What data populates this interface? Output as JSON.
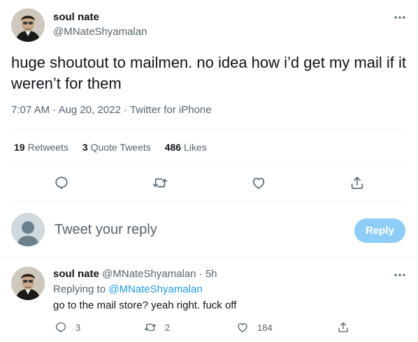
{
  "tweet": {
    "author_name": "soul nate",
    "author_handle": "@MNateShyamalan",
    "text": "huge shoutout to mailmen. no idea how i’d get my mail if it weren’t for them",
    "time": "7:07 AM",
    "date": "Aug 20, 2022",
    "source": "Twitter for iPhone",
    "separator": "·"
  },
  "stats": {
    "retweets_count": "19",
    "retweets_label": "Retweets",
    "quotes_count": "3",
    "quotes_label": "Quote Tweets",
    "likes_count": "486",
    "likes_label": "Likes"
  },
  "composer": {
    "placeholder": "Tweet your reply",
    "button_label": "Reply"
  },
  "reply": {
    "author_name": "soul nate",
    "author_handle": "@MNateShyamalan",
    "age": "5h",
    "replying_prefix": "Replying to",
    "replying_handle": "@MNateShyamalan",
    "text": "go to the mail store? yeah right. fuck off",
    "reply_count": "3",
    "retweet_count": "2",
    "like_count": "184"
  },
  "icons": {
    "more": "more-horizontal-icon",
    "reply": "speech-bubble-icon",
    "retweet": "retweet-arrows-icon",
    "like": "heart-icon",
    "share": "share-upload-icon"
  },
  "colors": {
    "text": "#0f1419",
    "muted": "#536471",
    "link": "#1d9bf0",
    "reply_button_disabled": "#8ecdf8",
    "divider": "#eff3f4"
  }
}
